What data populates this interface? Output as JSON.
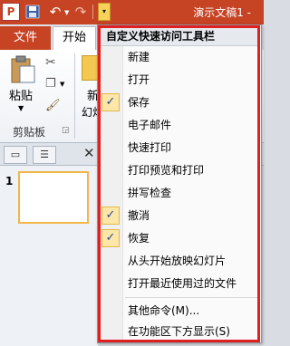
{
  "app": {
    "icon_letter": "P",
    "title": "演示文稿1 -"
  },
  "qat": {
    "undo_symbol": "↶",
    "redo_symbol": "↷",
    "customize_symbol": "▾"
  },
  "tabs": {
    "file": "文件",
    "home": "开始"
  },
  "ribbon": {
    "paste": "粘贴",
    "new_slide_1": "新",
    "new_slide_2": "幻灯",
    "clipboard_group": "剪贴板"
  },
  "panel": {
    "slide_number": "1",
    "close": "✕"
  },
  "menu": {
    "title": "自定义快速访问工具栏",
    "items": [
      {
        "label": "新建",
        "checked": false
      },
      {
        "label": "打开",
        "checked": false
      },
      {
        "label": "保存",
        "checked": true
      },
      {
        "label": "电子邮件",
        "checked": false
      },
      {
        "label": "快速打印",
        "checked": false
      },
      {
        "label": "打印预览和打印",
        "checked": false
      },
      {
        "label": "拼写检查",
        "checked": false
      },
      {
        "label": "撤消",
        "checked": true
      },
      {
        "label": "恢复",
        "checked": true
      },
      {
        "label": "从头开始放映幻灯片",
        "checked": false
      },
      {
        "label": "打开最近使用过的文件",
        "checked": false
      }
    ],
    "more_commands": "其他命令(M)...",
    "show_below": "在功能区下方显示(S)",
    "check_mark": "✓"
  },
  "colors": {
    "accent": "#c64324",
    "highlight_border": "#e02020",
    "check_bg": "#fde7a8"
  }
}
